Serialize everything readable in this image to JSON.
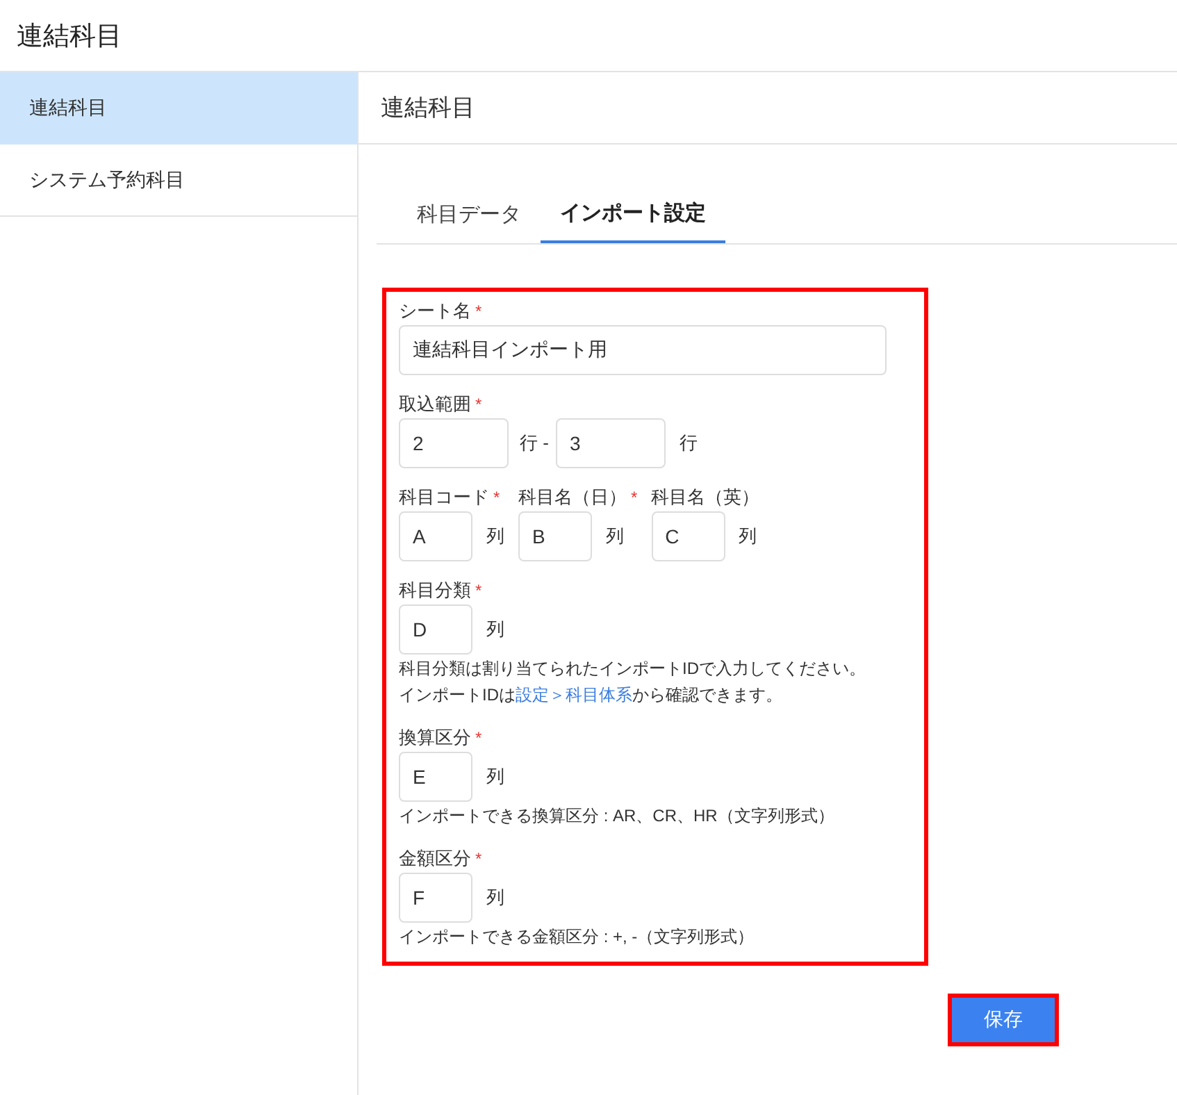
{
  "app_title": "連結科目",
  "sidebar": {
    "items": [
      {
        "label": "連結科目",
        "selected": true
      },
      {
        "label": "システム予約科目",
        "selected": false
      }
    ]
  },
  "page_title": "連結科目",
  "tabs": [
    {
      "label": "科目データ",
      "selected": false
    },
    {
      "label": "インポート設定",
      "selected": true
    }
  ],
  "form": {
    "highlighted": true,
    "sections": [
      {
        "kind": "text",
        "label": "シート名",
        "required_mark": "*",
        "value": "連結科目インポート用"
      },
      {
        "kind": "range",
        "label": "取込範囲",
        "required_mark": "*",
        "from": "2",
        "separator": "行 -",
        "to": "3",
        "unit": "行"
      },
      {
        "kind": "columns",
        "fields": [
          {
            "label": "科目コード",
            "required_mark": "*",
            "value": "A",
            "unit": "列"
          },
          {
            "label": "科目名（日）",
            "required_mark": "*",
            "value": "B",
            "unit": "列"
          },
          {
            "label": "科目名（英）",
            "value": "C",
            "unit": "列"
          }
        ]
      },
      {
        "kind": "column",
        "label": "科目分類",
        "required_mark": "*",
        "value": "D",
        "unit": "列",
        "notes": [
          {
            "text": "科目分類は割り当てられたインポートIDで入力してください。"
          },
          {
            "text": "インポートIDは",
            "link": "設定＞科目体系",
            "after": "から確認できます。"
          }
        ]
      },
      {
        "kind": "column",
        "label": "換算区分",
        "required_mark": "*",
        "value": "E",
        "unit": "列",
        "notes": [
          {
            "text": "インポートできる換算区分 : AR、CR、HR（文字列形式）"
          }
        ]
      },
      {
        "kind": "column",
        "label": "金額区分",
        "required_mark": "*",
        "value": "F",
        "unit": "列",
        "notes": [
          {
            "text": "インポートできる金額区分 : +, -（文字列形式）"
          }
        ]
      }
    ]
  },
  "save_button": {
    "label": "保存",
    "highlighted": true
  }
}
